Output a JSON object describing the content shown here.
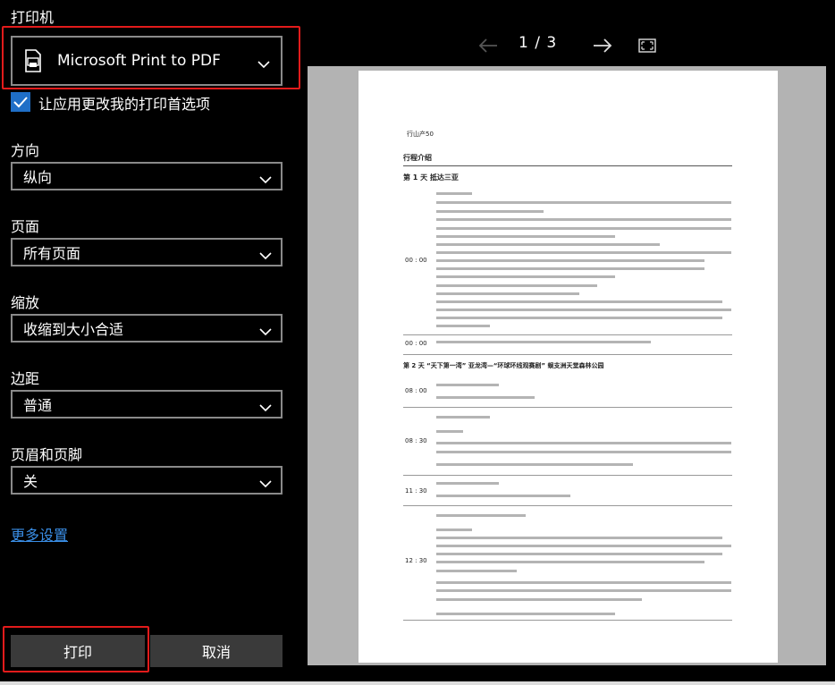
{
  "left_panel": {
    "printer_label": "打印机",
    "printer_value": "Microsoft Print to PDF",
    "allow_app_change_label": "让应用更改我的打印首选项",
    "orientation": {
      "label": "方向",
      "value": "纵向"
    },
    "pages": {
      "label": "页面",
      "value": "所有页面"
    },
    "scale": {
      "label": "缩放",
      "value": "收缩到大小合适"
    },
    "margins": {
      "label": "边距",
      "value": "普通"
    },
    "header_footer": {
      "label": "页眉和页脚",
      "value": "关"
    },
    "more_settings": "更多设置",
    "print_button": "打印",
    "cancel_button": "取消"
  },
  "preview": {
    "page_indicator": "1 / 3",
    "doc": {
      "header_small": "行山产50",
      "section_title": "行程介绍",
      "day1_title": "第 1 天 抵达三亚",
      "day1_time1": "00 : 00",
      "day1_time2": "00 : 00",
      "day2_title": "第 2 天 “天下第一湾” 亚龙湾—“环球环线观赛剧” 蜈支洲天堂森林公园",
      "times": [
        "08 : 00",
        "08 : 30",
        "11 : 30",
        "12 : 30"
      ]
    }
  },
  "colors": {
    "accent": "#1f6fc7",
    "highlight": "#e21b1b",
    "link": "#3a8ee6"
  }
}
